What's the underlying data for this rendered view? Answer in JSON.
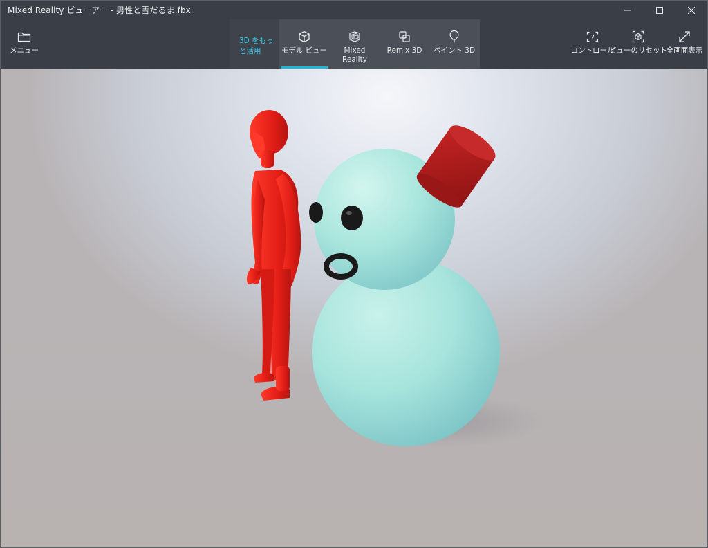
{
  "window": {
    "title": "Mixed Reality ビューアー - 男性と雪だるま.fbx"
  },
  "toolbar": {
    "menu_label": "メニュー",
    "cta_label_line1": "3D をもっ",
    "cta_label_line2": "と活用",
    "tabs": [
      {
        "label": "モデル ビュー",
        "icon": "cube-icon",
        "active": true
      },
      {
        "label_line1": "Mixed",
        "label_line2": "Reality",
        "icon": "mixed-reality-icon",
        "active": false
      },
      {
        "label": "Remix 3D",
        "icon": "remix3d-icon",
        "active": false
      },
      {
        "label": "ペイント 3D",
        "icon": "paint3d-icon",
        "active": false
      }
    ],
    "right_buttons": [
      {
        "label": "コントロール",
        "icon": "controls-help-icon"
      },
      {
        "label": "ビューのリセット",
        "icon": "reset-view-icon"
      },
      {
        "label": "全画面表示",
        "icon": "fullscreen-icon"
      }
    ]
  },
  "colors": {
    "titlebar_bg": "#3a3f47",
    "tab_group_bg": "#4b5058",
    "accent": "#1fb7d9",
    "cta_text": "#34c2e6",
    "figure_red": "#e8201a",
    "snowman_cyan": "#a7e6dc",
    "hat_red": "#b81d1d",
    "eye_black": "#1a1a1a"
  }
}
